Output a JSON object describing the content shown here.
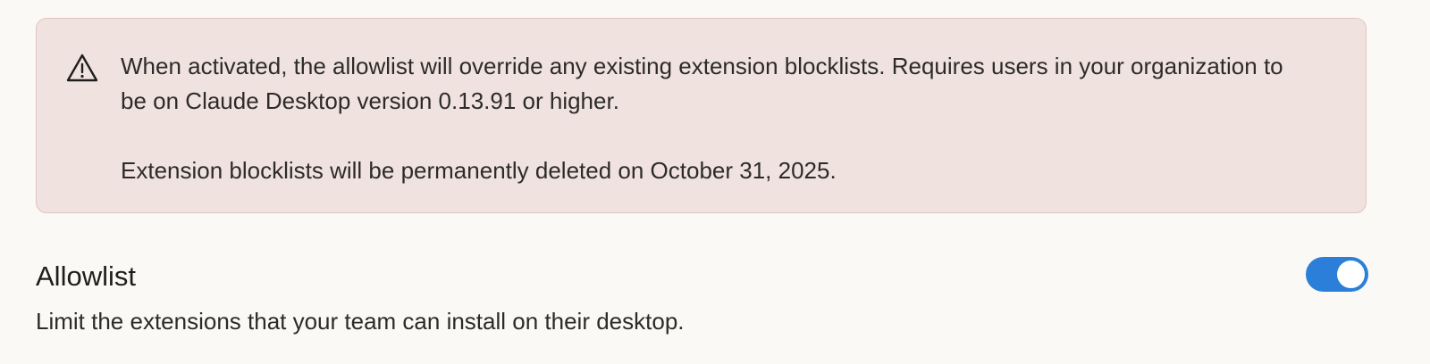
{
  "warning": {
    "icon": "warning-triangle-icon",
    "paragraph_1": "When activated, the allowlist will override any existing extension blocklists. Requires users in your organization to be on Claude Desktop version 0.13.91 or higher.",
    "paragraph_2": "Extension blocklists will be permanently deleted on October 31, 2025.",
    "background_color": "#f0e3df",
    "border_color": "#e2c4c0"
  },
  "allowlist": {
    "title": "Allowlist",
    "description": "Limit the extensions that your team can install on their desktop.",
    "toggle_on": true,
    "toggle_color": "#2b7fd8"
  }
}
